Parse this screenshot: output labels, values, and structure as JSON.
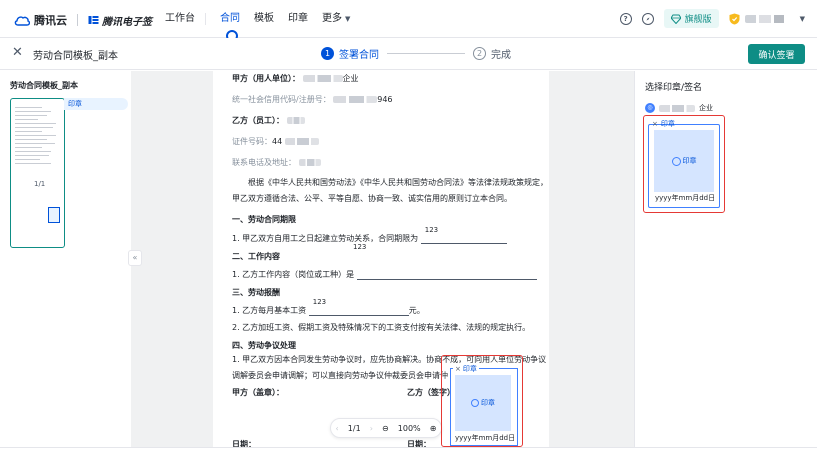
{
  "topbar": {
    "brand_name": "腾讯云",
    "product_name": "腾讯电子签",
    "nav": [
      {
        "label": "工作台"
      },
      {
        "label": "合同"
      },
      {
        "label": "模板"
      },
      {
        "label": "印章"
      },
      {
        "label": "更多"
      }
    ],
    "help_icon": "?",
    "vip_label": "旗舰版",
    "accent_color": "#0052d9",
    "brand_color": "#0e8d85"
  },
  "subbar": {
    "doc_title": "劳动合同模板_副本",
    "steps": [
      {
        "num": "1",
        "label": "签署合同"
      },
      {
        "num": "2",
        "label": "完成"
      }
    ],
    "confirm_label": "确认签署"
  },
  "left": {
    "title": "劳动合同模板_副本",
    "thumb_tag": "印章",
    "page_num": "1/1"
  },
  "doc": {
    "party_a": "甲方（用人单位）：",
    "party_a_suffix": "企业",
    "credit_code": "统一社会信用代码/注册号：",
    "credit_code_suffix": "946",
    "party_b": "乙方（员工）：",
    "id_no": "证件号码：",
    "id_no_prefix": "44",
    "phone": "联系电话及地址：",
    "intro": "根据《中华人民共和国劳动法》《中华人民共和国劳动合同法》等法律法规政策规定，甲乙双方遵循合法、公平、平等自愿、协商一致、诚实信用的原则订立本合同。",
    "s1_title": "一、劳动合同期限",
    "s1_text": "1. 甲乙双方自用工之日起建立劳动关系，合同期限为",
    "s1_value": "123",
    "s2_title": "二、工作内容",
    "s2_float": "123",
    "s2_text": "1. 乙方工作内容（岗位或工种）是",
    "s3_title": "三、劳动报酬",
    "s3_text": "1. 乙方每月基本工资",
    "s3_value": "123",
    "s3_suffix": "元。",
    "s3_text2": "2. 乙方加班工资、假期工资及特殊情况下的工资支付按有关法律、法规的规定执行。",
    "s4_title": "四、劳动争议处理",
    "s4_text": "1. 甲乙双方因本合同发生劳动争议时，应先协商解决。协商不成，可向用人单位劳动争议调解委员会申请调解；可以直接向劳动争议仲裁委员会申请仲",
    "sign_a": "甲方（盖章）：",
    "sign_b": "乙方（签字）：",
    "date_a": "日期：",
    "date_b": "日期："
  },
  "zoom": {
    "page": "1/1",
    "level": "100%"
  },
  "seal": {
    "tag": "印章",
    "label": "印章",
    "date": "yyyy年mm月dd日",
    "border_color": "#e53935"
  },
  "right": {
    "title": "选择印章/签名",
    "company_suffix": "企业",
    "seal_tag": "印章",
    "seal_label": "印章",
    "seal_date": "yyyy年mm月dd日"
  }
}
